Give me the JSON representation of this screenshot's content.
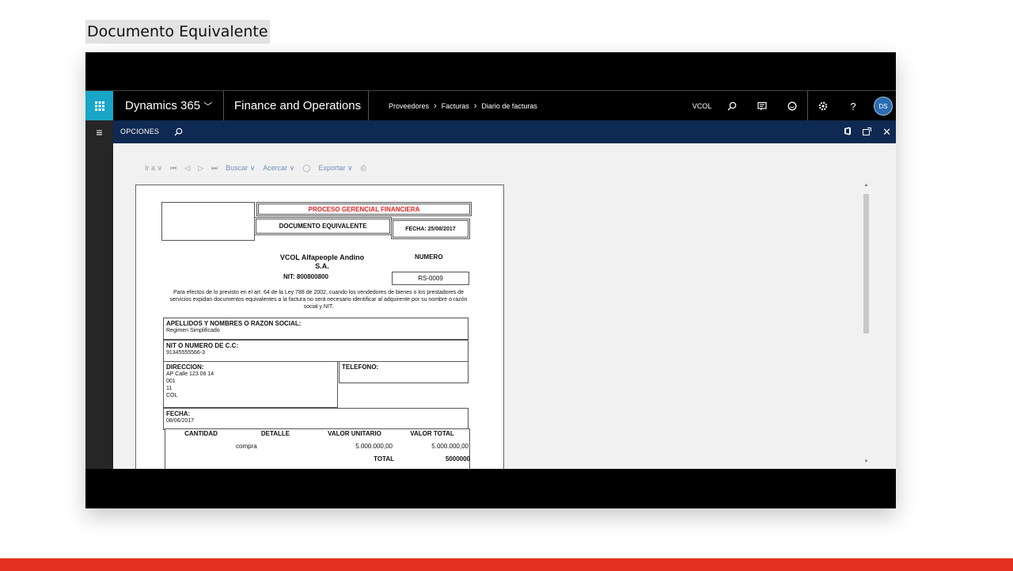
{
  "caption": "Documento Equivalente",
  "topnav": {
    "brand": "Dynamics 365",
    "brand_chevron": "﹀",
    "app": "Finance and Operations",
    "breadcrumbs": [
      "Proveedores",
      "Facturas",
      "Diario de facturas"
    ],
    "breadcrumb_sep": "›",
    "company": "VCOL",
    "avatar": "DS"
  },
  "actionbar": {
    "label": "OPCIONES"
  },
  "viewer_toolbar": {
    "goto": "Ir a",
    "search": "Buscar",
    "zoom": "Acercar",
    "export": "Exportar"
  },
  "report": {
    "title": "PROCESO GERENCIAL FINANCIERA",
    "doc_type": "DOCUMENTO EQUIVALENTE",
    "date_header": "FECHA: 25/08/2017",
    "company_line1": "VCOL Alfapeople Andino",
    "company_line2": "S.A.",
    "nit": "NIT: 800800800",
    "numero_label": "NUMERO",
    "numero_value": "RS-0009",
    "legal_text": "Para efectos de lo previsto en el art. 64 de la Ley 788 de 2002, cuando los vendedores de bienes o los prestadores de servicios expidan documentos equivalentes a la factura no será necesario identificar al adquirente por su nombre o razón social y NIT.",
    "name_label": "APELLIDOS Y NOMBRES O RAZON SOCIAL:",
    "name_value": "Regimen Simplificado",
    "id_label": "NIT O NUMERO DE C.C:",
    "id_value": "91345555566-3",
    "address_label": "DIRECCION:",
    "address_lines": [
      "AP Calle 123 06 14",
      "001",
      "11",
      "COL"
    ],
    "phone_label": "TELEFONO:",
    "fecha_label": "FECHA:",
    "fecha_value": "08/06/2017",
    "table": {
      "headers": [
        "CANTIDAD",
        "DETALLE",
        "VALOR UNITARIO",
        "VALOR TOTAL"
      ],
      "rows": [
        {
          "detalle": "compra",
          "unitario": "5.000.000,00",
          "total": "5.000.000,00"
        }
      ],
      "total_label": "TOTAL",
      "total_value": "5000000"
    }
  }
}
